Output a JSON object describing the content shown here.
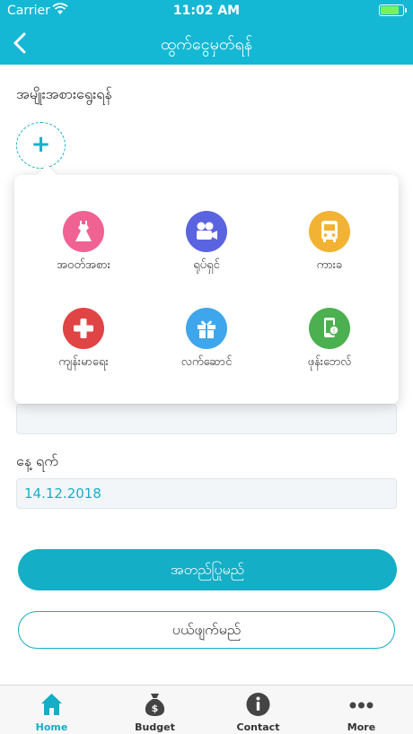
{
  "status_bar": {
    "carrier": "Carrier",
    "time": "11:02 AM"
  },
  "header": {
    "title": "ထွက်ငွေမှတ်ရန်"
  },
  "form": {
    "category_label": "အမျိုးအစားရွေးရန်",
    "add_symbol": "+",
    "date_label": "နေ့ ရက်",
    "date_value": "14.12.2018",
    "amount_value": ""
  },
  "categories": [
    {
      "label": "အဝတ်အစား",
      "color": "#f06292",
      "icon": "dress-icon"
    },
    {
      "label": "ရုပ်ရှင်",
      "color": "#5a63e0",
      "icon": "movie-camera-icon"
    },
    {
      "label": "ကား‌ခ",
      "color": "#f2b233",
      "icon": "bus-icon"
    },
    {
      "label": "ကျန်းမာရေး",
      "color": "#e04444",
      "icon": "medical-cross-icon"
    },
    {
      "label": "လက်ဆောင်",
      "color": "#3ea6ec",
      "icon": "gift-icon"
    },
    {
      "label": "ဖုန်းဘေလ်",
      "color": "#4caf50",
      "icon": "phone-bill-icon"
    }
  ],
  "buttons": {
    "save": "အတည်ပြုမည်",
    "cancel": "ပယ်ဖျက်မည်"
  },
  "tabs": [
    {
      "label": "Home",
      "icon": "home-icon"
    },
    {
      "label": "Budget",
      "icon": "money-bag-icon"
    },
    {
      "label": "Contact",
      "icon": "info-icon"
    },
    {
      "label": "More",
      "icon": "more-dots-icon"
    }
  ],
  "colors": {
    "accent": "#14b8d4",
    "active_tab": "#14aec6"
  }
}
